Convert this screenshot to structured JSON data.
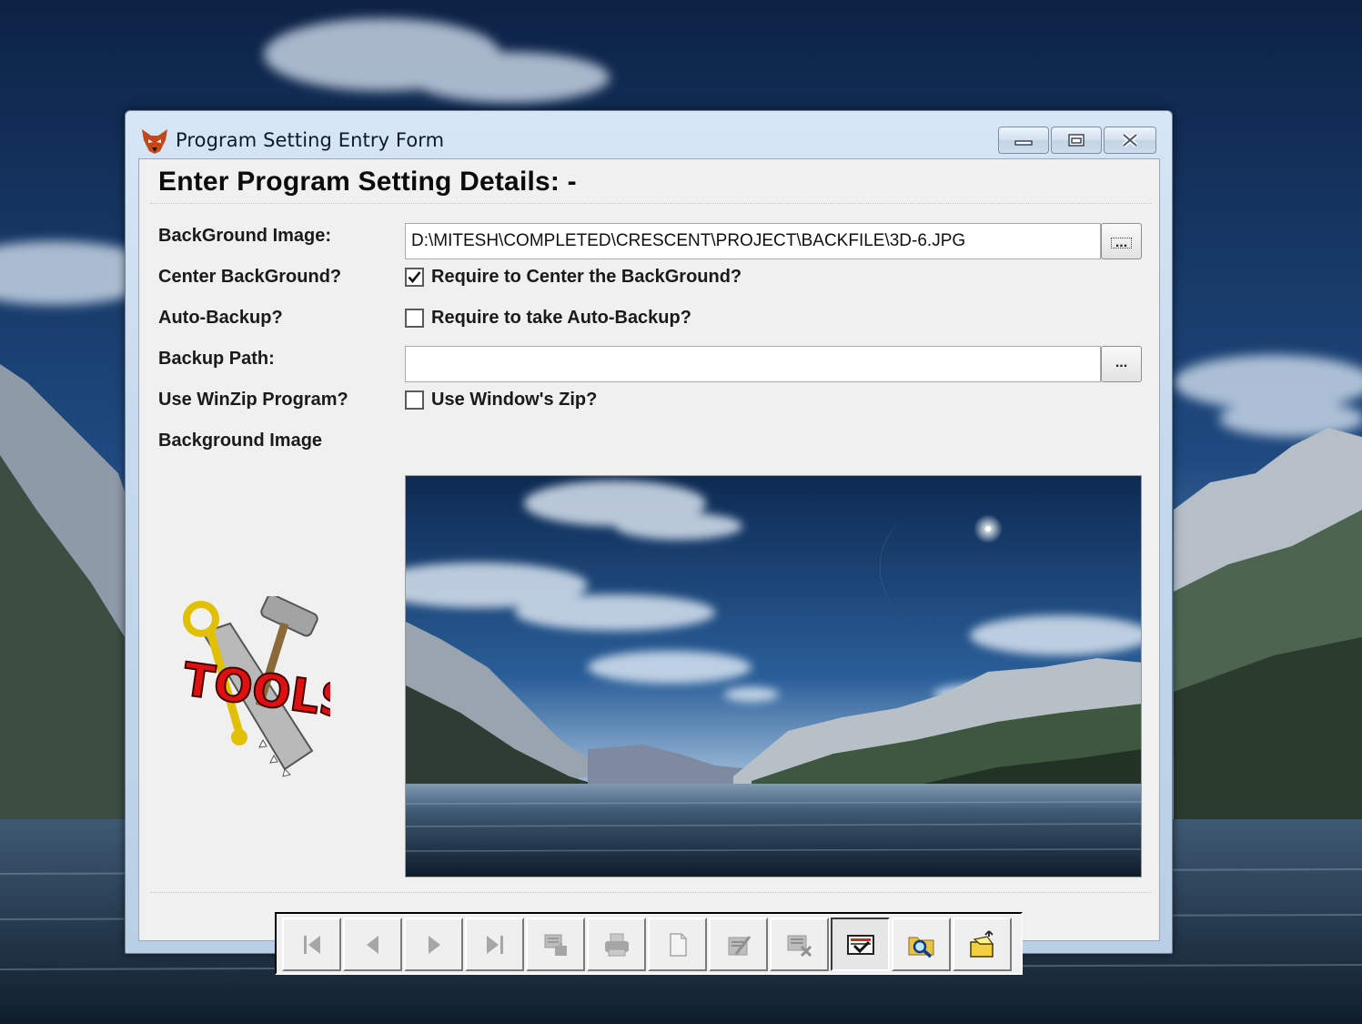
{
  "window": {
    "title": "Program Setting Entry Form",
    "heading": "Enter Program Setting Details: -"
  },
  "form": {
    "background_image_label": "BackGround Image:",
    "background_image_path": "D:\\MITESH\\COMPLETED\\CRESCENT\\PROJECT\\BACKFILE\\3D-6.JPG",
    "browse_label": "...",
    "center_background_label": "Center BackGround?",
    "center_background_checkbox_label": "Require to Center the BackGround?",
    "center_background_checked": true,
    "auto_backup_label": "Auto-Backup?",
    "auto_backup_checkbox_label": "Require to take Auto-Backup?",
    "auto_backup_checked": false,
    "backup_path_label": "Backup Path:",
    "backup_path_value": "",
    "backup_browse_label": "...",
    "winzip_label": "Use WinZip Program?",
    "winzip_checkbox_label": "Use Window's Zip?",
    "winzip_checked": false,
    "preview_label": "Background Image"
  },
  "toolbar": {
    "buttons": [
      {
        "icon": "first-record-icon",
        "enabled": false
      },
      {
        "icon": "previous-record-icon",
        "enabled": false
      },
      {
        "icon": "next-record-icon",
        "enabled": false
      },
      {
        "icon": "last-record-icon",
        "enabled": false
      },
      {
        "icon": "find-icon",
        "enabled": false
      },
      {
        "icon": "print-icon",
        "enabled": false
      },
      {
        "icon": "new-record-icon",
        "enabled": false
      },
      {
        "icon": "edit-record-icon",
        "enabled": false
      },
      {
        "icon": "delete-record-icon",
        "enabled": false
      },
      {
        "icon": "save-icon",
        "enabled": true,
        "pressed": true
      },
      {
        "icon": "search-folder-icon",
        "enabled": true
      },
      {
        "icon": "exit-icon",
        "enabled": true
      }
    ]
  },
  "colors": {
    "client_bg": "#f0f0f0",
    "title_bar": "#c6d9ec"
  }
}
